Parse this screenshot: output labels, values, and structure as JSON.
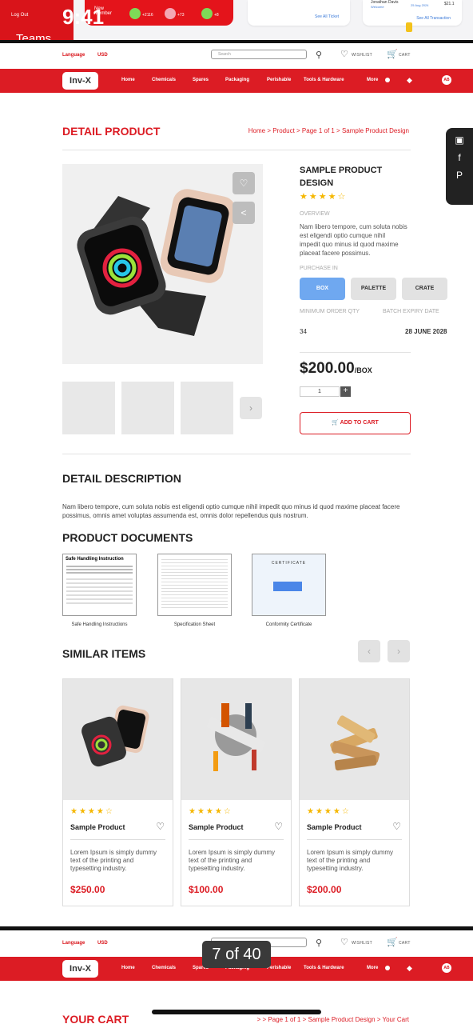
{
  "status": {
    "time": "9:41",
    "teams": "Teams",
    "logout": "Log Out",
    "new_member": "New Member",
    "stats": [
      "+2116",
      "+73",
      "+8"
    ],
    "see_all_ticket": "See All Ticket",
    "see_all_transaction": "See All Transaction",
    "user": "Jonathan Davis",
    "user_role": "Welcome",
    "date": "25 Aug 2024",
    "amount": "$21.1"
  },
  "header": {
    "language": "Language",
    "currency": "USD",
    "search_placeholder": "Search",
    "wishlist": "WISHLIST",
    "cart": "CART",
    "logo": "Inv-X",
    "nav": [
      "Home",
      "Chemicals",
      "Spares",
      "Packaging",
      "Perishable",
      "Tools & Hardware",
      "More"
    ],
    "avatar": "AB"
  },
  "page": {
    "title": "DETAIL PRODUCT",
    "breadcrumb": "Home > Product > Page 1 of 1 > Sample Product Design"
  },
  "product": {
    "name": "SAMPLE PRODUCT DESIGN",
    "rating": "★★★★☆",
    "overview_label": "OVERVIEW",
    "overview": "Nam libero tempore, cum soluta nobis est eligendi optio cumque nihil impedit quo minus id quod maxime placeat facere possimus.",
    "purchase_label": "PURCHASE IN",
    "purchase_options": [
      "BOX",
      "PALETTE",
      "CRATE"
    ],
    "moq_label": "MINIMUM ORDER QTY",
    "moq": "34",
    "expiry_label": "BATCH EXPIRY DATE",
    "expiry": "28 JUNE 2028",
    "price": "$200.00",
    "unit": "/BOX",
    "qty": "1",
    "add_to_cart": "ADD TO CART"
  },
  "description": {
    "title": "DETAIL DESCRIPTION",
    "text": "Nam libero tempore, cum soluta nobis est eligendi optio cumque nihil impedit quo minus id quod maxime placeat facere possimus, omnis amet voluptas assumenda est, omnis dolor repellendus quis nostrum."
  },
  "documents": {
    "title": "PRODUCT DOCUMENTS",
    "items": [
      "Safe Handling Instructions",
      "Specification Sheet",
      "Conformity Certificate"
    ],
    "doc1_heading": "Safe Handling Instruction",
    "doc3_heading": "CERTIFICATE"
  },
  "similar": {
    "title": "SIMILAR ITEMS",
    "items": [
      {
        "rating": "★★★★☆",
        "name": "Sample Product",
        "desc": "Lorem Ipsum is simply dummy text of the printing and typesetting industry.",
        "price": "$250.00"
      },
      {
        "rating": "★★★★☆",
        "name": "Sample Product",
        "desc": "Lorem Ipsum is simply dummy text of the printing and typesetting industry.",
        "price": "$100.00"
      },
      {
        "rating": "★★★★☆",
        "name": "Sample Product",
        "desc": "Lorem Ipsum is simply dummy text of the printing and typesetting industry.",
        "price": "$200.00"
      }
    ]
  },
  "next_page": {
    "counter": "7 of 40",
    "title": "YOUR CART",
    "breadcrumb": "> > Page 1 of 1 > Sample Product Design > Your Cart"
  },
  "colors": {
    "brand_red": "#dc1c24",
    "star": "#f5b700",
    "option_active": "#6fa8f0"
  }
}
